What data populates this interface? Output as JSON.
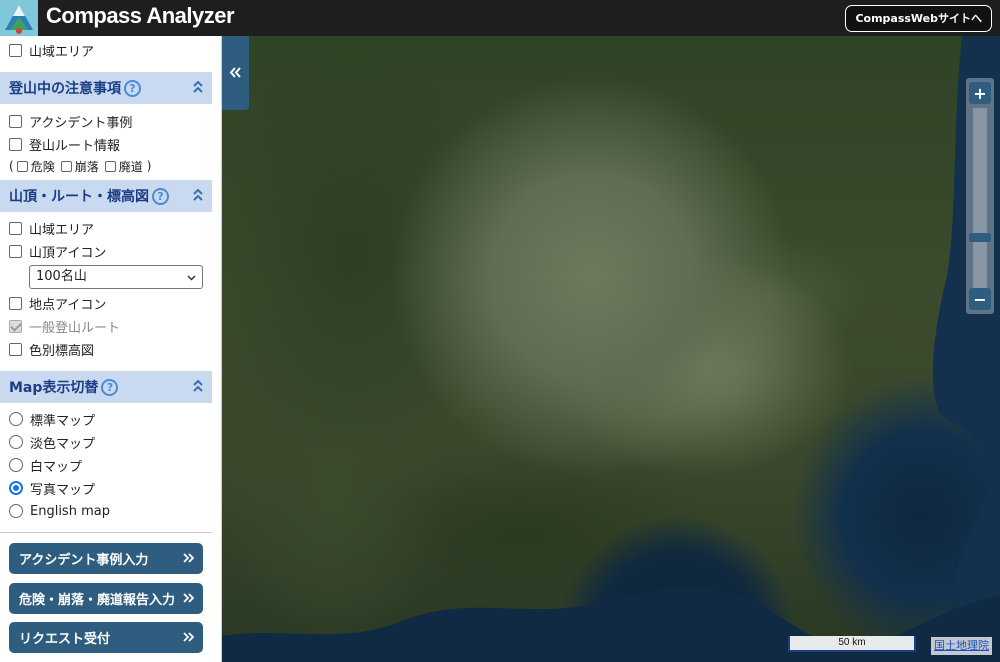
{
  "header": {
    "title": "Compass Analyzer",
    "web_button": "CompassWebサイトへ",
    "logo_icon": "compass-mountain-logo"
  },
  "sidebar": {
    "top_item": {
      "label": "山域エリア",
      "checked": false
    },
    "sections": [
      {
        "title": "登山中の注意事項",
        "items": [
          {
            "label": "アクシデント事例",
            "checked": false
          },
          {
            "label": "登山ルート情報",
            "checked": false
          }
        ],
        "sub": {
          "open": "(",
          "close": ")",
          "items": [
            "危険",
            "崩落",
            "廃道"
          ]
        }
      },
      {
        "title": "山頂・ルート・標高図",
        "items": [
          {
            "label": "山域エリア",
            "checked": false
          },
          {
            "label": "山頂アイコン",
            "checked": false
          },
          {
            "label": "地点アイコン",
            "checked": false
          },
          {
            "label": "一般登山ルート",
            "checked": true,
            "disabled": true
          },
          {
            "label": "色別標高図",
            "checked": false
          }
        ],
        "select_value": "100名山"
      },
      {
        "title": "Map表示切替",
        "items": [
          {
            "label": "標準マップ",
            "selected": false
          },
          {
            "label": "淡色マップ",
            "selected": false
          },
          {
            "label": "白マップ",
            "selected": false
          },
          {
            "label": "写真マップ",
            "selected": true
          },
          {
            "label": "English map",
            "selected": false
          }
        ]
      }
    ],
    "help_glyph": "?",
    "actions": [
      "アクシデント事例入力",
      "危険・崩落・廃道報告入力",
      "リクエスト受付"
    ]
  },
  "map": {
    "zoom_in": "+",
    "zoom_out": "−",
    "zoom_level_fraction": 0.73,
    "scale_label": "50 km",
    "attribution": "国土地理院",
    "accent_color": "#2f5d80"
  }
}
